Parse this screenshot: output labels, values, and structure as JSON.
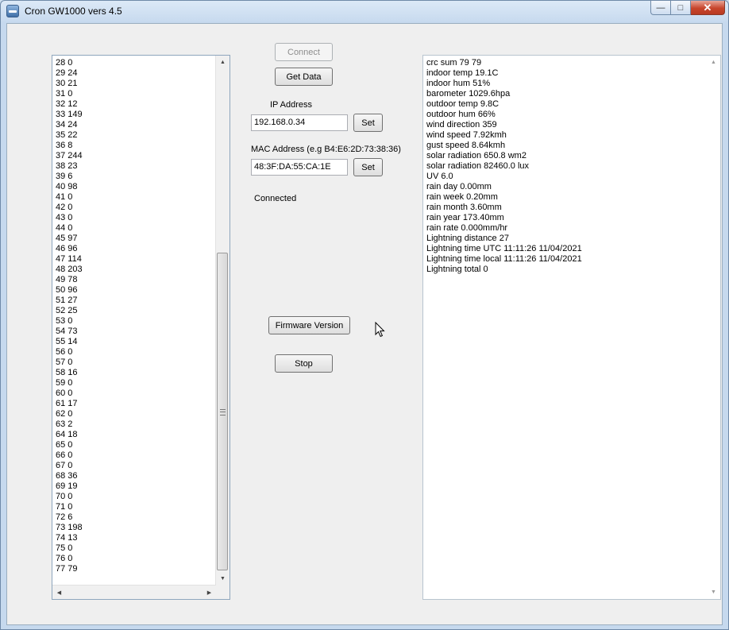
{
  "window": {
    "title": "Cron GW1000 vers 4.5",
    "controls": {
      "minimize": "—",
      "maximize": "□",
      "close": "✕"
    }
  },
  "left_list": {
    "items": [
      "28 0",
      "29 24",
      "30 21",
      "31 0",
      "32 12",
      "33 149",
      "34 24",
      "35 22",
      "36 8",
      "37 244",
      "38 23",
      "39 6",
      "40 98",
      "41 0",
      "42 0",
      "43 0",
      "44 0",
      "45 97",
      "46 96",
      "47 114",
      "48 203",
      "49 78",
      "50 96",
      "51 27",
      "52 25",
      "53 0",
      "54 73",
      "55 14",
      "56 0",
      "57 0",
      "58 16",
      "59 0",
      "60 0",
      "61 17",
      "62 0",
      "63 2",
      "64 18",
      "65 0",
      "66 0",
      "67 0",
      "68 36",
      "69 19",
      "70 0",
      "71 0",
      "72 6",
      "73 198",
      "74 13",
      "75 0",
      "76 0",
      "77 79"
    ],
    "scroll_position": 0.62
  },
  "buttons": {
    "connect": "Connect",
    "get_data": "Get Data",
    "set_ip": "Set",
    "set_mac": "Set",
    "firmware_version": "Firmware Version",
    "stop": "Stop"
  },
  "ip": {
    "label": "IP Address",
    "value": "192.168.0.34"
  },
  "mac": {
    "label": "MAC Address (e.g B4:E6:2D:73:38:36)",
    "value": "48:3F:DA:55:CA:1E"
  },
  "status": "Connected",
  "data_lines": [
    "crc sum 79 79",
    "indoor temp 19.1C",
    "indoor hum 51%",
    "barometer 1029.6hpa",
    "outdoor temp 9.8C",
    "outdoor hum 66%",
    "wind direction 359",
    "wind speed 7.92kmh",
    "gust speed 8.64kmh",
    "solar radiation 650.8 wm2",
    "solar radiation 82460.0 lux",
    "UV 6.0",
    "rain day 0.00mm",
    "rain week 0.20mm",
    "rain month 3.60mm",
    "rain year 173.40mm",
    "rain rate 0.000mm/hr",
    "Lightning distance 27",
    "Lightning time UTC 11:11:26 11/04/2021",
    "Lightning time local 11:11:26 11/04/2021",
    "Lightning total 0"
  ]
}
